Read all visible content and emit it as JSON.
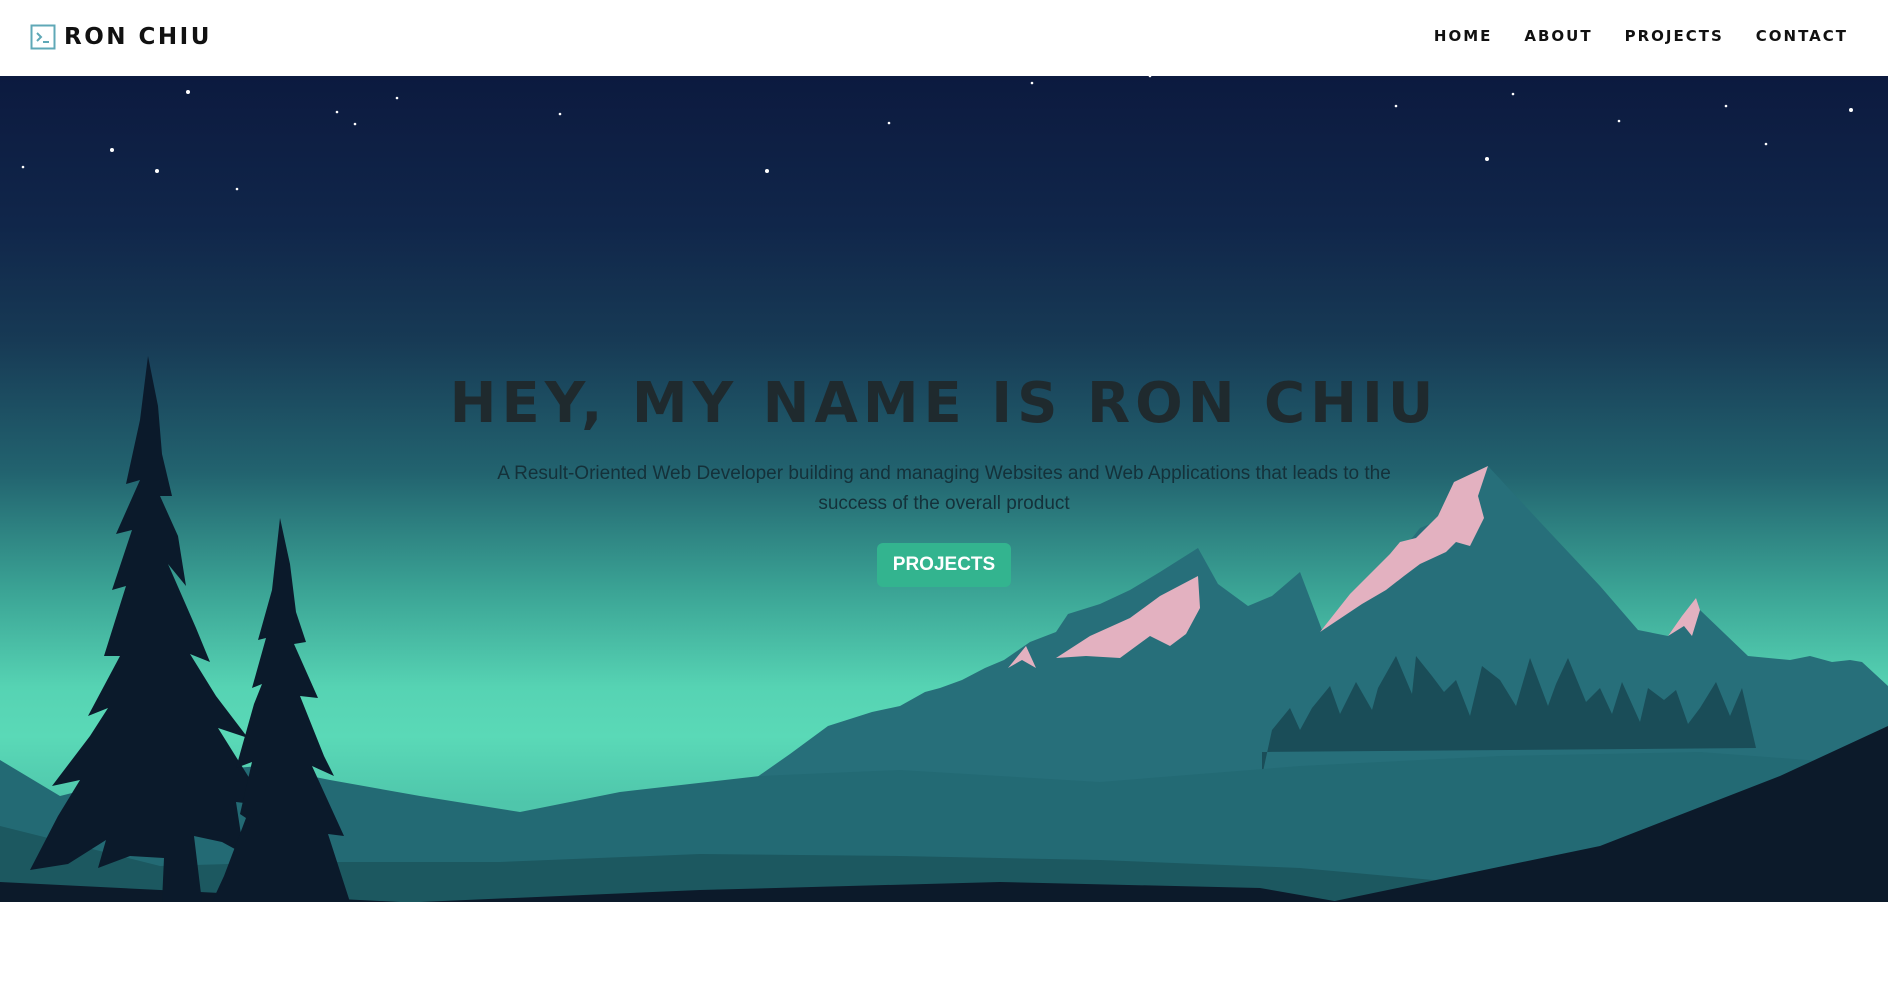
{
  "brand": {
    "name": "RON CHIU",
    "icon": "terminal-icon"
  },
  "nav": {
    "items": [
      {
        "label": "HOME"
      },
      {
        "label": "ABOUT"
      },
      {
        "label": "PROJECTS"
      },
      {
        "label": "CONTACT"
      }
    ]
  },
  "hero": {
    "title": "HEY, MY NAME IS RON CHIU",
    "subtitle": "A Result-Oriented Web Developer building and managing Websites and Web Applications that leads to the success of the overall product",
    "button_label": "PROJECTS"
  },
  "colors": {
    "sky_top": "#0c1a3f",
    "sky_bottom": "#5ad9b7",
    "accent": "#33b48f",
    "mountain": "#276f7a",
    "snow": "#e3b1c0",
    "trees": "#0b1a2b"
  }
}
